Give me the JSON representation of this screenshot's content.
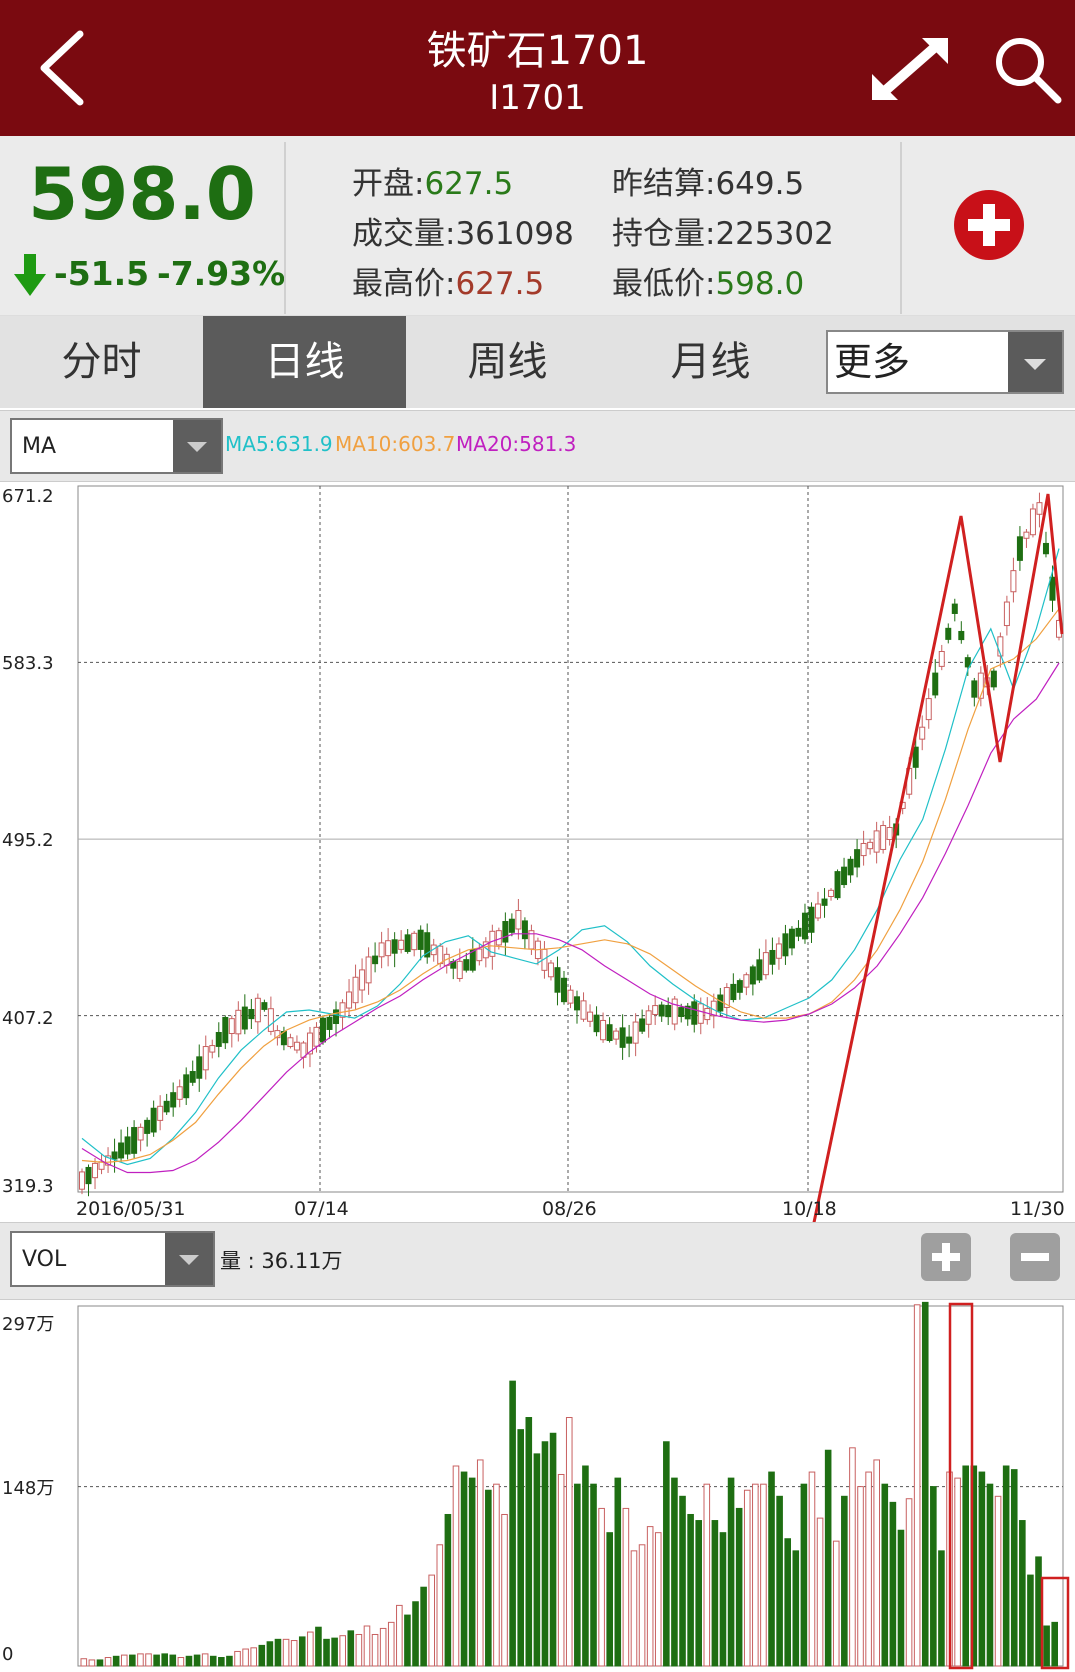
{
  "header": {
    "title": "铁矿石1701",
    "subtitle": "I1701"
  },
  "quote": {
    "price": "598.0",
    "change": "-51.5",
    "change_pct": "-7.93%",
    "stats": [
      {
        "label": "开盘:",
        "value": "627.5",
        "color": "green"
      },
      {
        "label": "昨结算:",
        "value": "649.5",
        "color": "neutral"
      },
      {
        "label": "成交量:",
        "value": "361098",
        "color": "neutral"
      },
      {
        "label": "持仓量:",
        "value": "225302",
        "color": "neutral"
      },
      {
        "label": "最高价:",
        "value": "627.5",
        "color": "red"
      },
      {
        "label": "最低价:",
        "value": "598.0",
        "color": "green"
      }
    ]
  },
  "tabs": {
    "items": [
      "分时",
      "日线",
      "周线",
      "月线"
    ],
    "active": 1,
    "more": "更多"
  },
  "ma_panel": {
    "selector": "MA",
    "ma5": "MA5:631.9",
    "ma10": "MA10:603.7",
    "ma20": "MA20:581.3",
    "colors": {
      "ma5": "#20c0c8",
      "ma10": "#f0a040",
      "ma20": "#c020c0"
    }
  },
  "vol_panel": {
    "selector": "VOL",
    "volume_text": "量 : 36.11万"
  },
  "colors": {
    "up": "#c86060",
    "down": "#1e6e12",
    "header": "#7a0a10",
    "annotation": "#d02020"
  },
  "chart_data": [
    {
      "type": "candlestick",
      "title": "",
      "yticks": [
        "671.2",
        "583.3",
        "495.2",
        "407.2",
        "319.3"
      ],
      "ylim": [
        319.3,
        671.2
      ],
      "xticks": [
        "2016/05/31",
        "07/14",
        "08/26",
        "10/18",
        "11/30"
      ],
      "series": [
        {
          "name": "MA5",
          "values": [
            346,
            337,
            333,
            336,
            346,
            359,
            376,
            390,
            400,
            409,
            410,
            408,
            406,
            412,
            423,
            437,
            444,
            447,
            439,
            436,
            433,
            440,
            450,
            452,
            444,
            432,
            423,
            415,
            409,
            405,
            406,
            411,
            416,
            425,
            440,
            460,
            485,
            505,
            540,
            580,
            600,
            570,
            600,
            640
          ]
        },
        {
          "name": "MA10",
          "values": [
            335,
            334,
            335,
            338,
            345,
            354,
            368,
            381,
            392,
            400,
            405,
            408,
            410,
            414,
            420,
            428,
            435,
            440,
            442,
            441,
            440,
            441,
            443,
            445,
            443,
            438,
            430,
            422,
            415,
            409,
            406,
            406,
            408,
            414,
            425,
            440,
            460,
            484,
            515,
            550,
            580,
            585,
            595,
            610
          ]
        },
        {
          "name": "MA20",
          "values": [
            341,
            334,
            329,
            329,
            330,
            335,
            344,
            355,
            367,
            379,
            389,
            397,
            404,
            411,
            417,
            425,
            432,
            438,
            444,
            448,
            448,
            445,
            440,
            432,
            425,
            418,
            413,
            410,
            407,
            405,
            404,
            405,
            408,
            413,
            421,
            432,
            448,
            466,
            488,
            512,
            538,
            555,
            565,
            583
          ]
        }
      ]
    },
    {
      "type": "bar",
      "title": "",
      "yticks": [
        "297万",
        "148万",
        "0"
      ],
      "ylim": [
        0,
        297
      ],
      "values": [
        6,
        5,
        5,
        7,
        8,
        9,
        9,
        10,
        10,
        9,
        10,
        9,
        7,
        8,
        9,
        10,
        8,
        7,
        8,
        12,
        14,
        15,
        17,
        20,
        22,
        22,
        21,
        24,
        28,
        32,
        22,
        23,
        25,
        29,
        26,
        33,
        26,
        31,
        36,
        50,
        42,
        53,
        65,
        75,
        100,
        125,
        165,
        160,
        155,
        170,
        145,
        150,
        125,
        235,
        195,
        205,
        175,
        185,
        192,
        158,
        205,
        150,
        165,
        150,
        130,
        110,
        155,
        130,
        95,
        100,
        115,
        110,
        185,
        155,
        140,
        125,
        120,
        150,
        120,
        110,
        155,
        130,
        145,
        150,
        150,
        160,
        140,
        105,
        95,
        150,
        160,
        122,
        178,
        103,
        140,
        180,
        148,
        160,
        170,
        150,
        135,
        112,
        138,
        298,
        300,
        148,
        95,
        160,
        155,
        165,
        165,
        160,
        150,
        140,
        165,
        162,
        120,
        75,
        90,
        33,
        36
      ]
    }
  ]
}
